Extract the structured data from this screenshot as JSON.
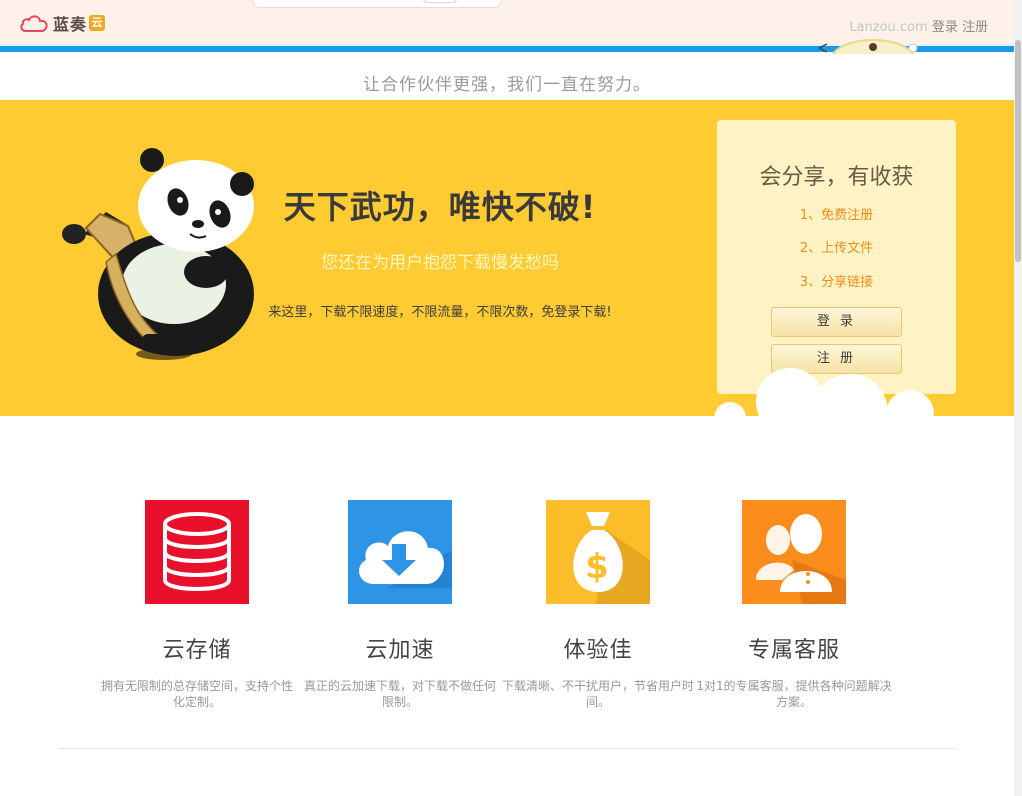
{
  "header": {
    "brand": "蓝奏",
    "brand_badge": "云",
    "domain": "Lanzou.com",
    "login": "登录",
    "register": "注册"
  },
  "tagline": "让合作伙伴更强，我们一直在努力。",
  "banner": {
    "title": "天下武功，唯快不破!",
    "subtitle": "您还在为用户抱怨下载慢发愁吗",
    "description": "来这里，下载不限速度，不限流量，不限次数，免登录下载!"
  },
  "share": {
    "title": "会分享，有收获",
    "steps": [
      "1、免费注册",
      "2、上传文件",
      "3、分享链接"
    ],
    "login_button": "登 录",
    "register_button": "注 册"
  },
  "features": [
    {
      "name": "云存储",
      "desc": "拥有无限制的总存储空间，支持个性化定制。",
      "color": "#e8102b",
      "icon": "database-icon"
    },
    {
      "name": "云加速",
      "desc": "真正的云加速下载，对下载不做任何限制。",
      "color": "#2e94e6",
      "icon": "cloud-download-icon"
    },
    {
      "name": "体验佳",
      "desc": "下载清晰、不干扰用户，节省用户时间。",
      "color": "#fbbd2a",
      "icon": "money-bag-icon"
    },
    {
      "name": "专属客服",
      "desc": "1对1的专属客服，提供各种问题解决方案。",
      "color": "#fb8d1c",
      "icon": "users-icon"
    }
  ],
  "colors": {
    "banner": "#ffcb32",
    "header_bg": "#fdf1e9",
    "accent_blue": "#1a9ae8",
    "step_orange": "#f08c1a"
  }
}
